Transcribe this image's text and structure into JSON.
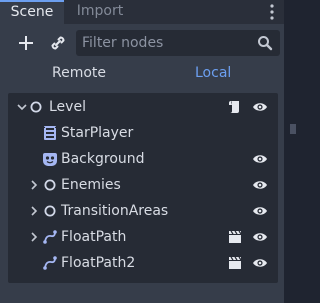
{
  "tabs": [
    {
      "label": "Scene",
      "active": true
    },
    {
      "label": "Import",
      "active": false
    }
  ],
  "toolbar": {
    "add_icon": "plus-icon",
    "link_icon": "link-icon",
    "filter_placeholder": "Filter nodes",
    "filter_value": "",
    "search_icon": "search-icon",
    "menu_icon": "vertical-dots-icon"
  },
  "remote_local": {
    "remote_label": "Remote",
    "local_label": "Local",
    "active": "Local"
  },
  "tree": [
    {
      "label": "Level",
      "icon": "node-circle-icon",
      "expanded": true,
      "script_icon": true,
      "visibility": true,
      "movie_icon": false
    },
    {
      "label": "StarPlayer",
      "icon": "animated-sprite-icon",
      "expanded": null,
      "script_icon": false,
      "visibility": false,
      "movie_icon": false
    },
    {
      "label": "Background",
      "icon": "sprite-icon",
      "expanded": null,
      "script_icon": false,
      "visibility": true,
      "movie_icon": false
    },
    {
      "label": "Enemies",
      "icon": "node-circle-icon",
      "expanded": false,
      "script_icon": false,
      "visibility": true,
      "movie_icon": false
    },
    {
      "label": "TransitionAreas",
      "icon": "node-circle-icon",
      "expanded": false,
      "script_icon": false,
      "visibility": true,
      "movie_icon": false
    },
    {
      "label": "FloatPath",
      "icon": "path-icon",
      "expanded": false,
      "script_icon": false,
      "visibility": true,
      "movie_icon": true
    },
    {
      "label": "FloatPath2",
      "icon": "path-icon",
      "expanded": null,
      "script_icon": false,
      "visibility": true,
      "movie_icon": true
    }
  ],
  "colors": {
    "accent": "#6c9ff0",
    "node_icon": "#a5b7f3",
    "sprite_icon": "#a5b7f3",
    "path_icon": "#a5b7f3"
  }
}
